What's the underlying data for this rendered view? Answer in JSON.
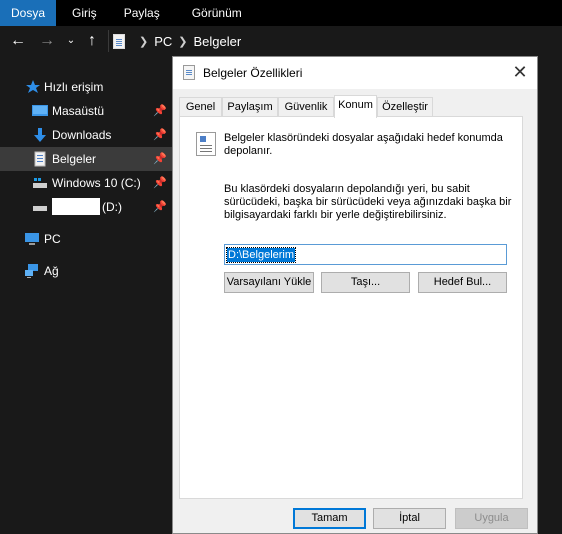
{
  "ribbon": {
    "tabs": [
      "Dosya",
      "Giriş",
      "Paylaş",
      "Görünüm"
    ]
  },
  "address": {
    "crumbs": [
      "PC",
      "Belgeler"
    ]
  },
  "sidebar": {
    "quick_access": "Hızlı erişim",
    "items": [
      {
        "label": "Masaüstü",
        "icon": "desktop-icon"
      },
      {
        "label": "Downloads",
        "icon": "download-arrow-icon"
      },
      {
        "label": "Belgeler",
        "icon": "documents-icon"
      },
      {
        "label": "Windows 10 (C:)",
        "icon": "drive-icon"
      },
      {
        "label": "(D:)",
        "icon": "drive-icon"
      }
    ],
    "pc": "PC",
    "network": "Ağ"
  },
  "dialog": {
    "title": "Belgeler Özellikleri",
    "tabs": [
      "Genel",
      "Paylaşım",
      "Güvenlik",
      "Konum",
      "Özelleştir"
    ],
    "active_tab": "Konum",
    "intro": "Belgeler klasöründeki dosyalar aşağıdaki hedef konumda depolanır.",
    "description": "Bu klasördeki dosyaların depolandığı yeri, bu sabit sürücüdeki, başka bir sürücüdeki veya ağınızdaki başka bir bilgisayardaki farklı bir yerle değiştirebilirsiniz.",
    "path_value": "D:\\Belgelerim",
    "buttons": {
      "restore": "Varsayılanı Yükle",
      "move": "Taşı...",
      "find_target": "Hedef Bul...",
      "ok": "Tamam",
      "cancel": "İptal",
      "apply": "Uygula"
    }
  },
  "colors": {
    "accent": "#1a6fb8",
    "selection": "#0078d7",
    "dark_bg": "#191919"
  }
}
